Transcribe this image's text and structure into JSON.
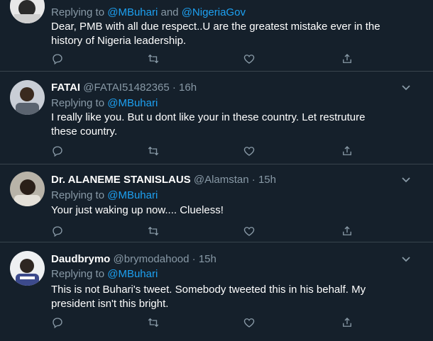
{
  "tweets": [
    {
      "name": "",
      "handle": "",
      "time": "",
      "reply_prefix": "Replying to",
      "mentions": [
        "@MBuhari",
        "@NigeriaGov"
      ],
      "mention_joiner": "and",
      "text": "Dear,  PMB with all due respect..U are the  greatest mistake ever in the history of Nigeria leadership."
    },
    {
      "name": "FATAI",
      "handle": "@FATAI51482365",
      "time": "16h",
      "reply_prefix": "Replying to",
      "mentions": [
        "@MBuhari"
      ],
      "text": "I really like you. But u dont like your in these country. Let restruture these country."
    },
    {
      "name": "Dr. ALANEME STANISLAUS",
      "handle": "@Alamstan",
      "time": "15h",
      "reply_prefix": "Replying to",
      "mentions": [
        "@MBuhari"
      ],
      "text": "Your just waking up now.... Clueless!"
    },
    {
      "name": "Daudbrymo",
      "handle": "@brymodahood",
      "time": "15h",
      "reply_prefix": "Replying to",
      "mentions": [
        "@MBuhari"
      ],
      "text": "This is not Buhari's tweet. Somebody tweeted this in his behalf. My president isn't this bright."
    }
  ],
  "separator": "·",
  "icons": {
    "reply": "reply-icon",
    "retweet": "retweet-icon",
    "like": "like-icon",
    "share": "share-icon",
    "more": "chevron-down-icon"
  },
  "colors": {
    "background": "#15202b",
    "link": "#1da1f2",
    "muted": "#8899a6",
    "divider": "#38444d"
  }
}
